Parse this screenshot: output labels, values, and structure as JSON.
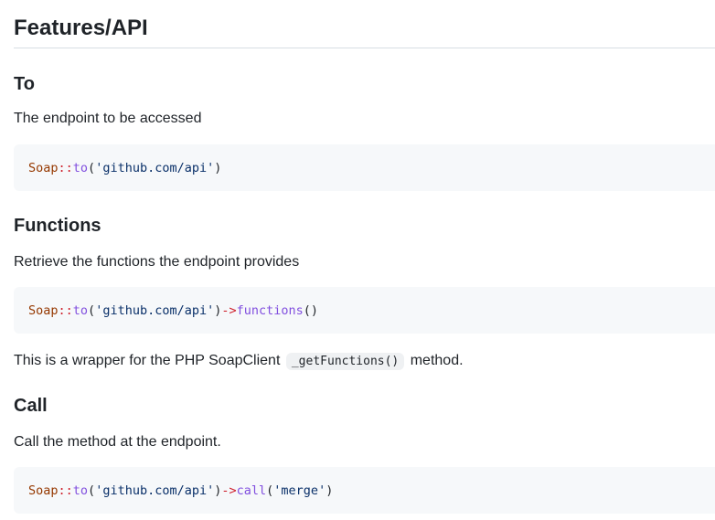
{
  "title": "Features/API",
  "sections": [
    {
      "heading": "To",
      "description": "The endpoint to be accessed",
      "code": {
        "class": "Soap",
        "op1": "::",
        "method1": "to",
        "p1_open": "(",
        "arg1": "'github.com/api'",
        "p1_close": ")"
      }
    },
    {
      "heading": "Functions",
      "description": "Retrieve the functions the endpoint provides",
      "code": {
        "class": "Soap",
        "op1": "::",
        "method1": "to",
        "p1_open": "(",
        "arg1": "'github.com/api'",
        "p1_close": ")",
        "op2": "->",
        "method2": "functions",
        "p2": "()"
      },
      "note": {
        "before": "This is a wrapper for the PHP SoapClient",
        "code": "_getFunctions()",
        "after": "method."
      }
    },
    {
      "heading": "Call",
      "description": "Call the method at the endpoint.",
      "code": {
        "class": "Soap",
        "op1": "::",
        "method1": "to",
        "p1_open": "(",
        "arg1": "'github.com/api'",
        "p1_close": ")",
        "op2": "->",
        "method2": "call",
        "p2_open": "(",
        "arg2": "'merge'",
        "p2_close": ")"
      }
    }
  ]
}
